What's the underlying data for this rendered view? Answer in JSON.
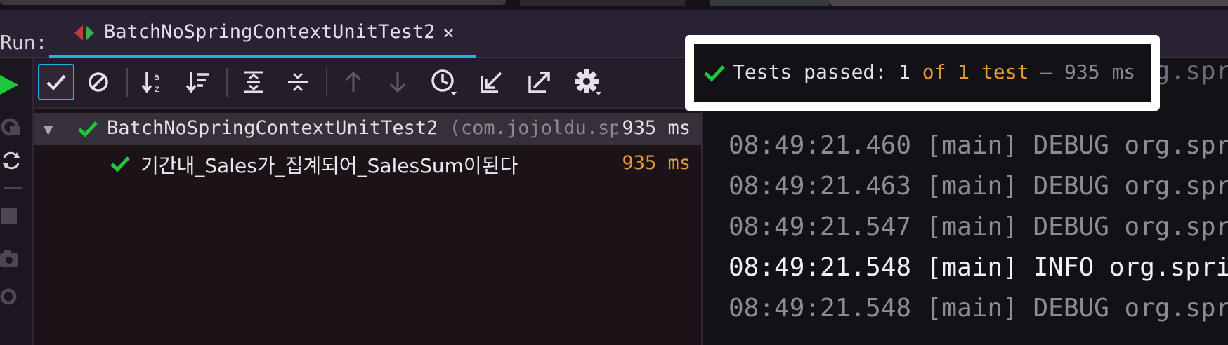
{
  "run_bar": {
    "label": "Run:",
    "tab_name": "BatchNoSpringContextUnitTest2",
    "close_glyph": "×"
  },
  "toolbar": {
    "buttons": [
      {
        "name": "show-passed-button",
        "icon": "checkmark-icon",
        "active": true
      },
      {
        "name": "show-ignored-button",
        "icon": "no-entry-icon"
      },
      {
        "name": "sort-alphabetically-button",
        "icon": "sort-alpha-icon"
      },
      {
        "name": "sort-by-duration-button",
        "icon": "sort-duration-icon"
      },
      {
        "name": "expand-all-button",
        "icon": "expand-all-icon"
      },
      {
        "name": "collapse-all-button",
        "icon": "collapse-all-icon"
      },
      {
        "name": "previous-failed-button",
        "icon": "arrow-up-icon"
      },
      {
        "name": "next-failed-button",
        "icon": "arrow-down-icon"
      },
      {
        "name": "test-history-button",
        "icon": "history-clock-icon"
      },
      {
        "name": "import-tests-button",
        "icon": "import-icon"
      },
      {
        "name": "export-tests-button",
        "icon": "export-icon"
      },
      {
        "name": "settings-button",
        "icon": "gear-icon"
      }
    ]
  },
  "status": {
    "prefix": "Tests passed: ",
    "passed": "1",
    "of_total": " of 1 test",
    "duration": " – 935 ms"
  },
  "tree": {
    "root": {
      "name": "BatchNoSpringContextUnitTest2",
      "package": " (com.jojoldu.spr",
      "time": "935 ms"
    },
    "child": {
      "name": "기간내_Sales가_집계되어_SalesSum이된다",
      "time": "935 ms"
    }
  },
  "console": {
    "lines": [
      {
        "text": "08:49:21.460 [main] DEBUG org.spr",
        "level": "debug"
      },
      {
        "text": "08:49:21.463 [main] DEBUG org.spr",
        "level": "debug"
      },
      {
        "text": "08:49:21.547 [main] DEBUG org.spr",
        "level": "debug"
      },
      {
        "text": "08:49:21.548 [main] INFO org.spri",
        "level": "info"
      },
      {
        "text": "08:49:21.548 [main] DEBUG org.spr",
        "level": "debug"
      }
    ]
  },
  "colors": {
    "accent": "#22b4d8",
    "pass_green": "#22c53d",
    "duration_orange": "#e39a35",
    "run_green": "#1fc73a"
  }
}
